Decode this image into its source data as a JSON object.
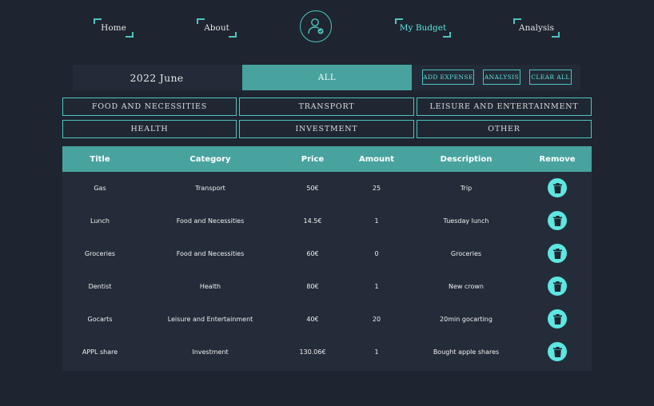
{
  "nav": {
    "items": [
      {
        "label": "Home"
      },
      {
        "label": "About"
      },
      {
        "label": "My Budget"
      },
      {
        "label": "Analysis"
      }
    ],
    "logo_icon": "user-check-icon"
  },
  "toolbar": {
    "month": "2022 June",
    "all_label": "ALL",
    "add_expense": "ADD EXPENSE",
    "analysis": "ANALYSIS",
    "clear_all": "CLEAR ALL"
  },
  "categories": [
    "FOOD AND NECESSITIES",
    "TRANSPORT",
    "LEISURE AND ENTERTAINMENT",
    "HEALTH",
    "INVESTMENT",
    "OTHER"
  ],
  "table": {
    "headers": [
      "Title",
      "Category",
      "Price",
      "Amount",
      "Description",
      "Remove"
    ],
    "rows": [
      {
        "title": "Gas",
        "category": "Transport",
        "price": "50€",
        "amount": "25",
        "description": "Trip"
      },
      {
        "title": "Lunch",
        "category": "Food and Necessities",
        "price": "14.5€",
        "amount": "1",
        "description": "Tuesday lunch"
      },
      {
        "title": "Groceries",
        "category": "Food and Necessities",
        "price": "60€",
        "amount": "0",
        "description": "Groceries"
      },
      {
        "title": "Dentist",
        "category": "Health",
        "price": "80€",
        "amount": "1",
        "description": "New crown"
      },
      {
        "title": "Gocarts",
        "category": "Leisure and Entertainment",
        "price": "40€",
        "amount": "20",
        "description": "20min gocarting"
      },
      {
        "title": "APPL share",
        "category": "Investment",
        "price": "130.06€",
        "amount": "1",
        "description": "Bought apple shares"
      }
    ],
    "remove_icon": "trash-icon"
  },
  "colors": {
    "background": "#1e2530",
    "accent": "#48a39f",
    "accent_light": "#5ee6e1"
  }
}
